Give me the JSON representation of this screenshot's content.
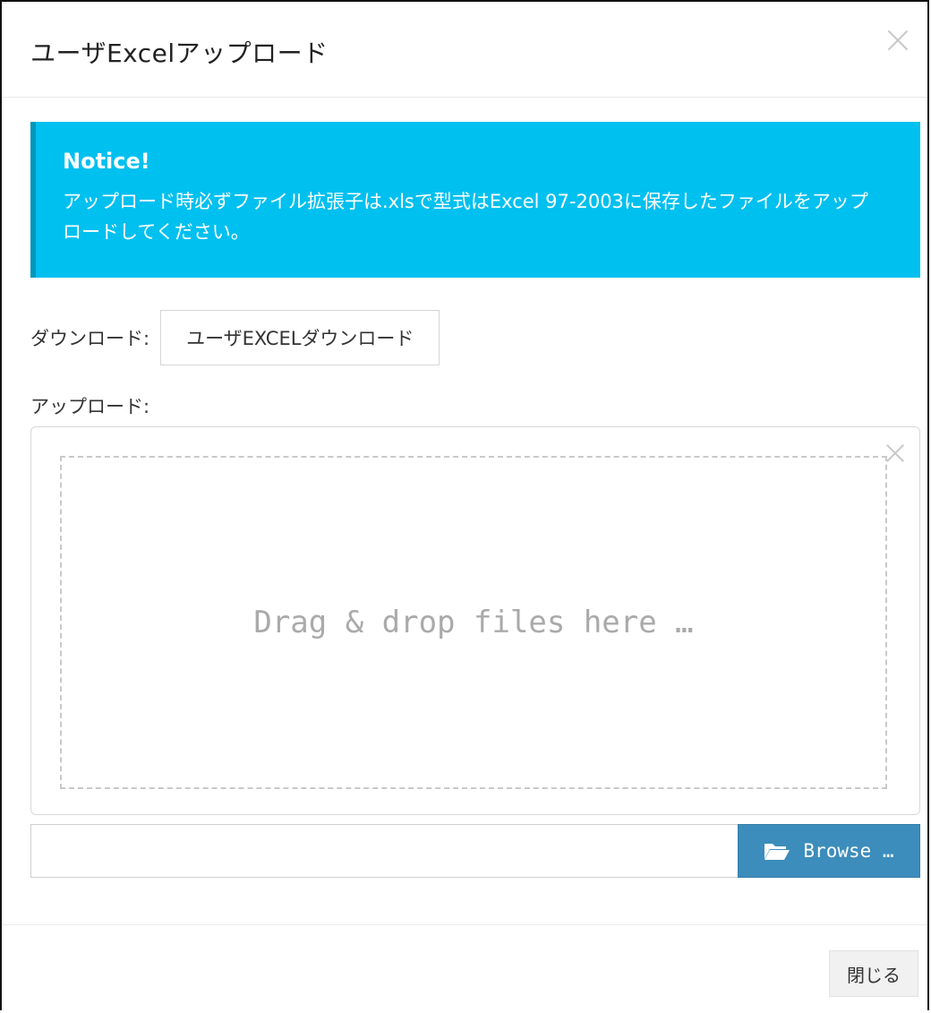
{
  "modal": {
    "title": "ユーザExcelアップロード"
  },
  "notice": {
    "title": "Notice!",
    "text": "アップロード時必ずファイル拡張子は.xlsで型式はExcel 97-2003に保存したファイルをアップロードしてください。",
    "color": "#00c0ef"
  },
  "download": {
    "label": "ダウンロード:",
    "button_label": "ユーザEXCELダウンロード"
  },
  "upload": {
    "label": "アップロード:",
    "dropzone_text": "Drag & drop files here …",
    "file_input_value": "",
    "browse_label": "Browse …",
    "browse_color": "#3c8dbc"
  },
  "footer": {
    "close_label": "閉じる"
  }
}
